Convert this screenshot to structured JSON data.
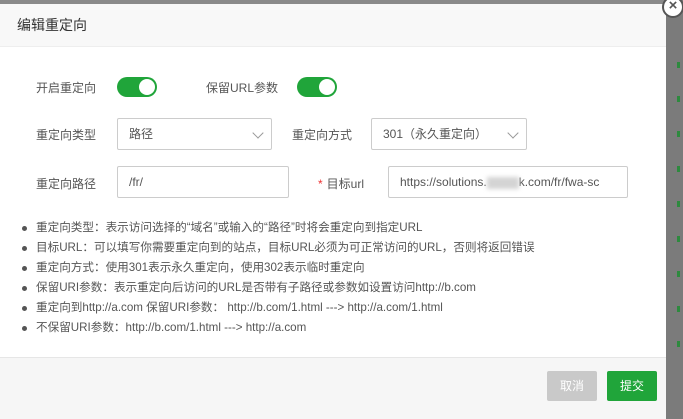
{
  "dialog": {
    "title": "编辑重定向",
    "close_glyph": "×"
  },
  "form": {
    "enable_redirect_label": "开启重定向",
    "enable_redirect_on": true,
    "keep_url_params_label": "保留URL参数",
    "keep_url_params_on": true,
    "redirect_type_label": "重定向类型",
    "redirect_type_value": "路径",
    "redirect_method_label": "重定向方式",
    "redirect_method_value": "301（永久重定向）",
    "redirect_path_label": "重定向路径",
    "redirect_path_value": "/fr/",
    "target_url_required": "*",
    "target_url_label": "目标url",
    "target_url_prefix": "https://solutions.",
    "target_url_suffix": "k.com/fr/fwa-sc"
  },
  "tips": [
    "重定向类型：表示访问选择的“域名”或输入的“路径”时将会重定向到指定URL",
    "目标URL：可以填写你需要重定向到的站点，目标URL必须为可正常访问的URL，否则将返回错误",
    "重定向方式：使用301表示永久重定向，使用302表示临时重定向",
    "保留URI参数：表示重定向后访问的URL是否带有子路径或参数如设置访问http://b.com",
    "重定向到http://a.com 保留URI参数： http://b.com/1.html ---> http://a.com/1.html",
    "不保留URI参数：http://b.com/1.html ---> http://a.com"
  ],
  "footer": {
    "cancel_label": "取消",
    "submit_label": "提交"
  },
  "colors": {
    "accent": "#20a53a",
    "required": "#e33333",
    "disabled_button": "#c9c9c9"
  },
  "icons": {
    "close": "close-icon",
    "select_arrow": "chevron-down-icon"
  }
}
